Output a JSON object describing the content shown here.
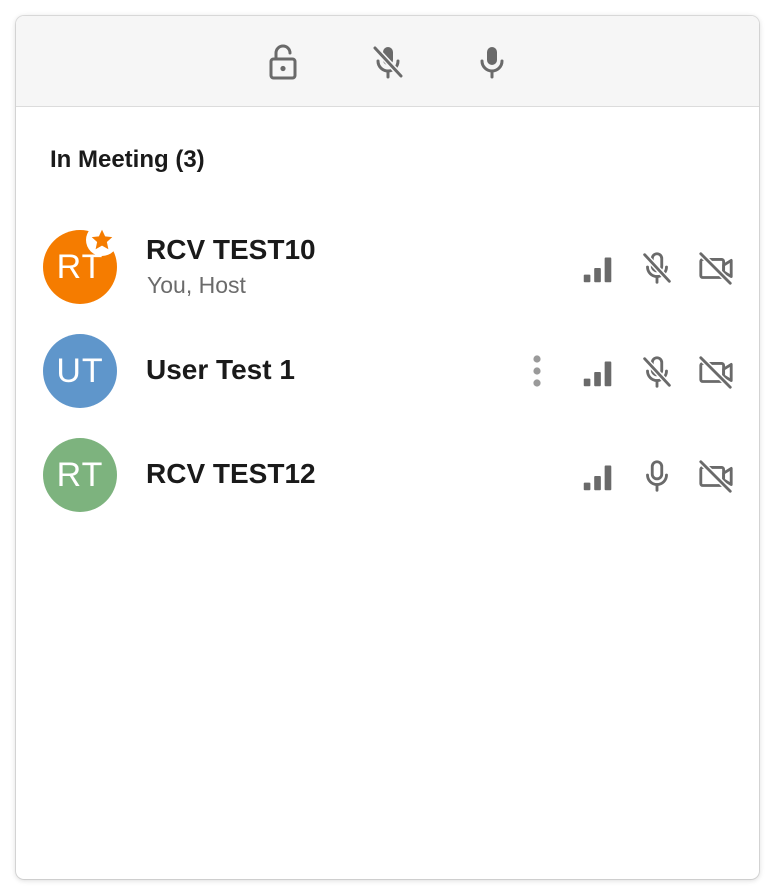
{
  "toolbar": {
    "buttons": [
      {
        "icon": "lock-open-icon"
      },
      {
        "icon": "mic-off-icon"
      },
      {
        "icon": "mic-icon"
      }
    ]
  },
  "section": {
    "title": "In Meeting (3)"
  },
  "participants": [
    {
      "initials": "RT",
      "name": "RCV TEST10",
      "subtitle": "You, Host",
      "avatar_color": "#f57c00",
      "host": true,
      "signal_icon": "signal-bars-icon",
      "mic_icon": "mic-off-icon",
      "video_icon": "video-off-icon"
    },
    {
      "initials": "UT",
      "name": "User Test 1",
      "subtitle": "",
      "avatar_color": "#5f96cb",
      "more_menu": true,
      "signal_icon": "signal-bars-icon",
      "mic_icon": "mic-off-icon",
      "video_icon": "video-off-icon"
    },
    {
      "initials": "RT",
      "name": "RCV TEST12",
      "subtitle": "",
      "avatar_color": "#7db37e",
      "signal_icon": "signal-bars-icon",
      "mic_icon": "mic-icon",
      "video_icon": "video-off-icon"
    }
  ],
  "colors": {
    "icon": "#6a6a6a",
    "host_star": "#f57c00",
    "toolbar_bg": "#f6f6f6"
  }
}
